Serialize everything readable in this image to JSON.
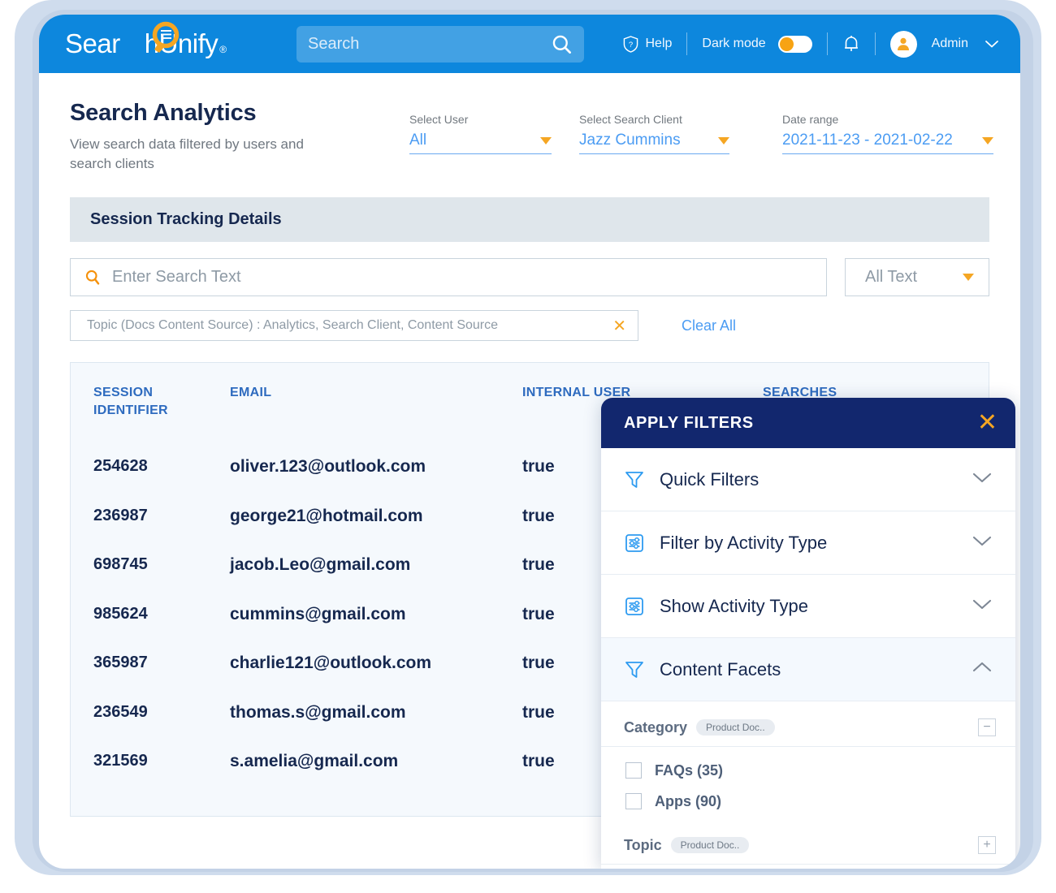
{
  "brand": {
    "name_part1": "Sear",
    "name_part2": "hUnify",
    "registered": "®",
    "logo_icon": "magnifier-document-logo",
    "primary_color": "#0d87dd",
    "accent_color": "#f5a623",
    "navy_color": "#12276e"
  },
  "topbar": {
    "search_placeholder": "Search",
    "search_icon": "search-icon",
    "help_label": "Help",
    "help_icon": "help-shield-icon",
    "dark_mode_label": "Dark mode",
    "dark_mode_on": true,
    "bell_icon": "notification-bell-icon",
    "user_label": "Admin",
    "avatar_icon": "user-avatar-icon",
    "chevron_icon": "chevron-down-icon"
  },
  "page": {
    "title": "Search Analytics",
    "subtitle": "View search data filtered by users and search clients"
  },
  "filters_bar": [
    {
      "label": "Select User",
      "value": "All"
    },
    {
      "label": "Select Search Client",
      "value": "Jazz Cummins"
    },
    {
      "label": "Date range",
      "value": "2021-11-23  -  2021-02-22"
    }
  ],
  "session_section": {
    "title": "Session Tracking Details",
    "search_placeholder": "Enter Search Text",
    "search_icon": "search-icon",
    "text_scope_value": "All Text",
    "topic_chip": "Topic (Docs Content Source) : Analytics, Search Client, Content Source",
    "topic_chip_remove": "✕",
    "clear_all_label": "Clear All"
  },
  "table": {
    "columns": [
      "SESSION IDENTIFIER",
      "EMAIL",
      "INTERNAL USER",
      "SEARCHES"
    ],
    "col_session_line1": "SESSION",
    "col_session_line2": "IDENTIFIER",
    "col_email": "EMAIL",
    "col_internal_user": "INTERNAL USER",
    "col_searches": "SEARCHES",
    "rows": [
      {
        "session": "254628",
        "email": "oliver.123@outlook.com",
        "internal_user": "true",
        "searches": ""
      },
      {
        "session": "236987",
        "email": "george21@hotmail.com",
        "internal_user": "true",
        "searches": ""
      },
      {
        "session": "698745",
        "email": "jacob.Leo@gmail.com",
        "internal_user": "true",
        "searches": ""
      },
      {
        "session": "985624",
        "email": "cummins@gmail.com",
        "internal_user": "true",
        "searches": ""
      },
      {
        "session": "365987",
        "email": "charlie121@outlook.com",
        "internal_user": "true",
        "searches": ""
      },
      {
        "session": "236549",
        "email": "thomas.s@gmail.com",
        "internal_user": "true",
        "searches": ""
      },
      {
        "session": "321569",
        "email": "s.amelia@gmail.com",
        "internal_user": "true",
        "searches": ""
      }
    ]
  },
  "filters_panel": {
    "title": "APPLY FILTERS",
    "close_icon": "close-icon",
    "sections": [
      {
        "label": "Quick Filters",
        "icon": "funnel-icon",
        "state": "collapsed",
        "chevron": "chevron-down-icon"
      },
      {
        "label": "Filter by Activity Type",
        "icon": "sliders-icon",
        "state": "collapsed",
        "chevron": "chevron-down-icon"
      },
      {
        "label": "Show Activity Type",
        "icon": "sliders-icon",
        "state": "collapsed",
        "chevron": "chevron-down-icon"
      },
      {
        "label": "Content Facets",
        "icon": "funnel-icon",
        "state": "expanded",
        "chevron": "chevron-up-icon"
      }
    ],
    "facets": [
      {
        "name": "Category",
        "pill": "Product Doc..",
        "toggle": "−",
        "toggle_icon": "minus-box-icon",
        "options": [
          {
            "label": "FAQs (35)",
            "checked": false
          },
          {
            "label": "Apps (90)",
            "checked": false
          }
        ]
      },
      {
        "name": "Topic",
        "pill": "Product Doc..",
        "toggle": "+",
        "toggle_icon": "plus-box-icon",
        "options": []
      }
    ]
  }
}
